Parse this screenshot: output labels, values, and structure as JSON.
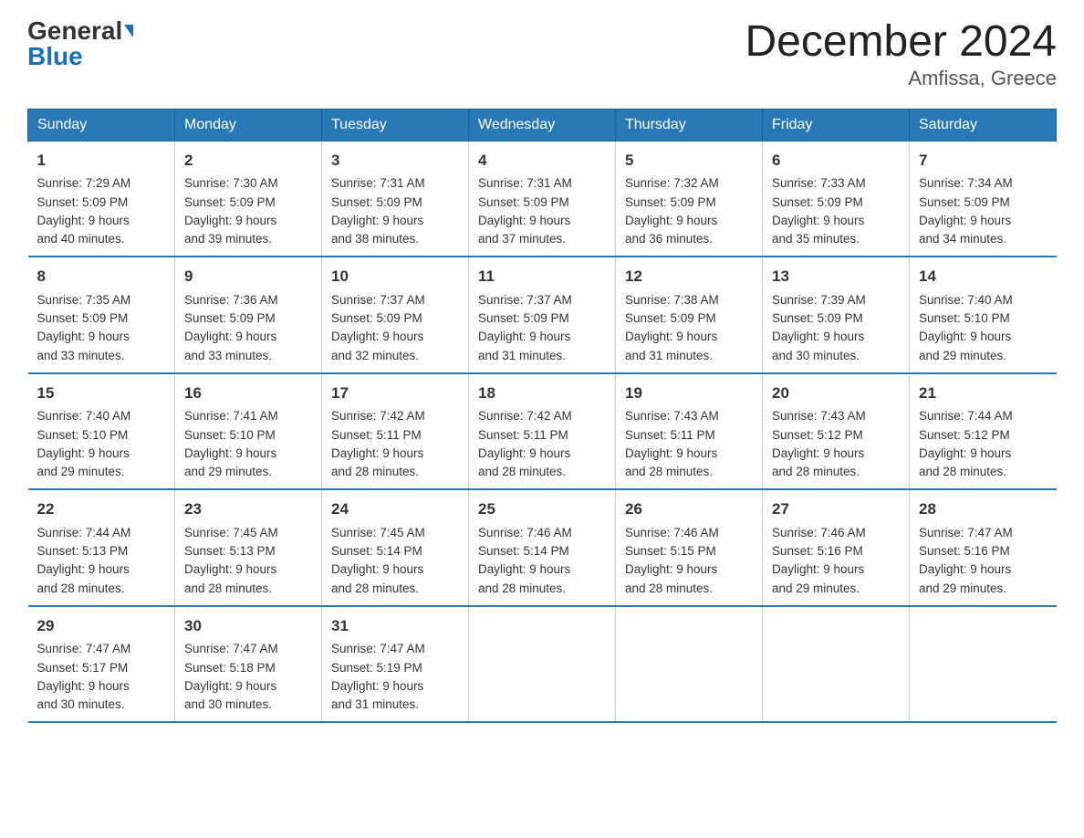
{
  "header": {
    "logo_general": "General",
    "logo_blue": "Blue",
    "title": "December 2024",
    "subtitle": "Amfissa, Greece"
  },
  "days_of_week": [
    "Sunday",
    "Monday",
    "Tuesday",
    "Wednesday",
    "Thursday",
    "Friday",
    "Saturday"
  ],
  "weeks": [
    [
      {
        "day": "1",
        "sunrise": "7:29 AM",
        "sunset": "5:09 PM",
        "daylight": "9 hours and 40 minutes."
      },
      {
        "day": "2",
        "sunrise": "7:30 AM",
        "sunset": "5:09 PM",
        "daylight": "9 hours and 39 minutes."
      },
      {
        "day": "3",
        "sunrise": "7:31 AM",
        "sunset": "5:09 PM",
        "daylight": "9 hours and 38 minutes."
      },
      {
        "day": "4",
        "sunrise": "7:31 AM",
        "sunset": "5:09 PM",
        "daylight": "9 hours and 37 minutes."
      },
      {
        "day": "5",
        "sunrise": "7:32 AM",
        "sunset": "5:09 PM",
        "daylight": "9 hours and 36 minutes."
      },
      {
        "day": "6",
        "sunrise": "7:33 AM",
        "sunset": "5:09 PM",
        "daylight": "9 hours and 35 minutes."
      },
      {
        "day": "7",
        "sunrise": "7:34 AM",
        "sunset": "5:09 PM",
        "daylight": "9 hours and 34 minutes."
      }
    ],
    [
      {
        "day": "8",
        "sunrise": "7:35 AM",
        "sunset": "5:09 PM",
        "daylight": "9 hours and 33 minutes."
      },
      {
        "day": "9",
        "sunrise": "7:36 AM",
        "sunset": "5:09 PM",
        "daylight": "9 hours and 33 minutes."
      },
      {
        "day": "10",
        "sunrise": "7:37 AM",
        "sunset": "5:09 PM",
        "daylight": "9 hours and 32 minutes."
      },
      {
        "day": "11",
        "sunrise": "7:37 AM",
        "sunset": "5:09 PM",
        "daylight": "9 hours and 31 minutes."
      },
      {
        "day": "12",
        "sunrise": "7:38 AM",
        "sunset": "5:09 PM",
        "daylight": "9 hours and 31 minutes."
      },
      {
        "day": "13",
        "sunrise": "7:39 AM",
        "sunset": "5:09 PM",
        "daylight": "9 hours and 30 minutes."
      },
      {
        "day": "14",
        "sunrise": "7:40 AM",
        "sunset": "5:10 PM",
        "daylight": "9 hours and 29 minutes."
      }
    ],
    [
      {
        "day": "15",
        "sunrise": "7:40 AM",
        "sunset": "5:10 PM",
        "daylight": "9 hours and 29 minutes."
      },
      {
        "day": "16",
        "sunrise": "7:41 AM",
        "sunset": "5:10 PM",
        "daylight": "9 hours and 29 minutes."
      },
      {
        "day": "17",
        "sunrise": "7:42 AM",
        "sunset": "5:11 PM",
        "daylight": "9 hours and 28 minutes."
      },
      {
        "day": "18",
        "sunrise": "7:42 AM",
        "sunset": "5:11 PM",
        "daylight": "9 hours and 28 minutes."
      },
      {
        "day": "19",
        "sunrise": "7:43 AM",
        "sunset": "5:11 PM",
        "daylight": "9 hours and 28 minutes."
      },
      {
        "day": "20",
        "sunrise": "7:43 AM",
        "sunset": "5:12 PM",
        "daylight": "9 hours and 28 minutes."
      },
      {
        "day": "21",
        "sunrise": "7:44 AM",
        "sunset": "5:12 PM",
        "daylight": "9 hours and 28 minutes."
      }
    ],
    [
      {
        "day": "22",
        "sunrise": "7:44 AM",
        "sunset": "5:13 PM",
        "daylight": "9 hours and 28 minutes."
      },
      {
        "day": "23",
        "sunrise": "7:45 AM",
        "sunset": "5:13 PM",
        "daylight": "9 hours and 28 minutes."
      },
      {
        "day": "24",
        "sunrise": "7:45 AM",
        "sunset": "5:14 PM",
        "daylight": "9 hours and 28 minutes."
      },
      {
        "day": "25",
        "sunrise": "7:46 AM",
        "sunset": "5:14 PM",
        "daylight": "9 hours and 28 minutes."
      },
      {
        "day": "26",
        "sunrise": "7:46 AM",
        "sunset": "5:15 PM",
        "daylight": "9 hours and 28 minutes."
      },
      {
        "day": "27",
        "sunrise": "7:46 AM",
        "sunset": "5:16 PM",
        "daylight": "9 hours and 29 minutes."
      },
      {
        "day": "28",
        "sunrise": "7:47 AM",
        "sunset": "5:16 PM",
        "daylight": "9 hours and 29 minutes."
      }
    ],
    [
      {
        "day": "29",
        "sunrise": "7:47 AM",
        "sunset": "5:17 PM",
        "daylight": "9 hours and 30 minutes."
      },
      {
        "day": "30",
        "sunrise": "7:47 AM",
        "sunset": "5:18 PM",
        "daylight": "9 hours and 30 minutes."
      },
      {
        "day": "31",
        "sunrise": "7:47 AM",
        "sunset": "5:19 PM",
        "daylight": "9 hours and 31 minutes."
      },
      null,
      null,
      null,
      null
    ]
  ]
}
